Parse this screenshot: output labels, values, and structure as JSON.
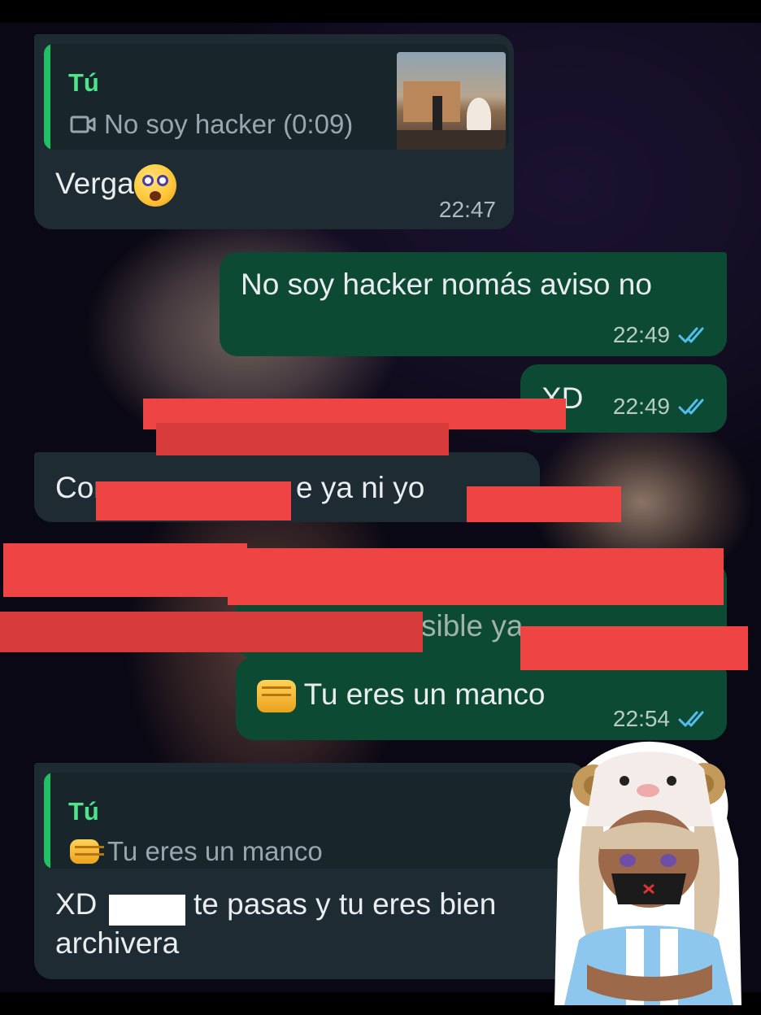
{
  "messages": {
    "m1": {
      "quote_author": "Tú",
      "quote_icon": "video-icon",
      "quote_text": "No soy hacker (0:09)",
      "text": "Verga",
      "emoji": "dizzy-face-emoji",
      "time": "22:47"
    },
    "m2": {
      "text": "No soy hacker nomás aviso no",
      "time": "22:49"
    },
    "m3": {
      "text": "XD",
      "time": "22:49"
    },
    "m4": {
      "text_a": "Com",
      "text_b": "e ya ni yo"
    },
    "m5": {
      "text": "sible ya"
    },
    "m6": {
      "emoji": "fist-emoji",
      "text": "Tu eres un manco",
      "time": "22:54"
    },
    "m7": {
      "quote_author": "Tú",
      "quote_icon": "fist-emoji",
      "quote_text": "Tu eres un manco",
      "text_a": "XD",
      "text_b": "te pasas y tu eres bien",
      "text_c": "archivera"
    }
  },
  "colors": {
    "incoming_bubble": "#1f2b32",
    "outgoing_bubble": "#0d4a34",
    "quote_accent": "#21c063",
    "read_ticks": "#53bdeb",
    "censor": "#ee4444"
  }
}
